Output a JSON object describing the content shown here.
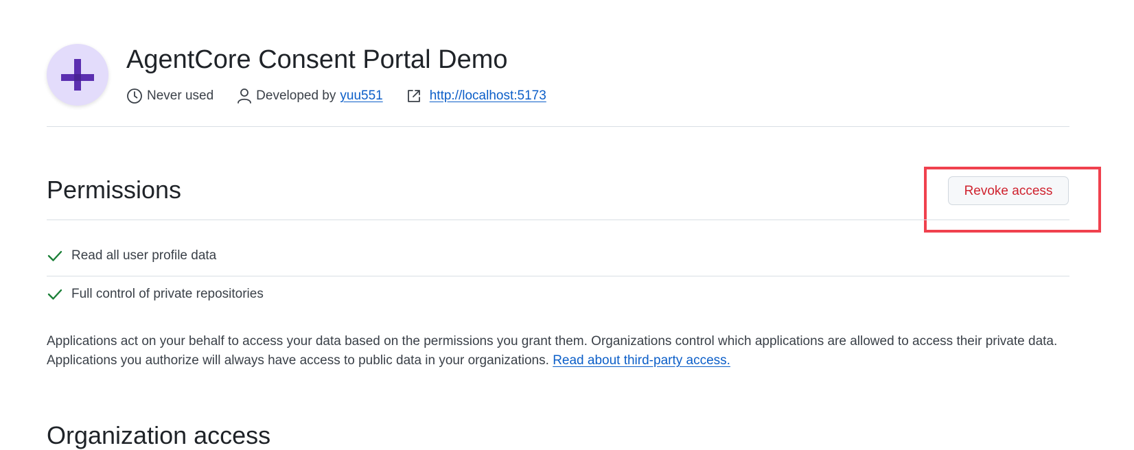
{
  "app": {
    "title": "AgentCore Consent Portal Demo",
    "last_used": "Never used",
    "developed_by_prefix": "Developed by",
    "developer": "yuu551",
    "url": "http://localhost:5173",
    "avatar_color": "#e3dcfb",
    "avatar_glyph_color": "#5b2fb0"
  },
  "permissions": {
    "title": "Permissions",
    "revoke_label": "Revoke access",
    "items": [
      {
        "label": "Read all user profile data",
        "icon": "check-icon"
      },
      {
        "label": "Full control of private repositories",
        "icon": "check-icon"
      }
    ],
    "description": "Applications act on your behalf to access your data based on the permissions you grant them. Organizations control which applications are allowed to access their private data. Applications you authorize will always have access to public data in your organizations.",
    "learn_more_link": "Read about third-party access."
  },
  "organization": {
    "title": "Organization access"
  },
  "colors": {
    "danger": "#cf222e",
    "link": "#0b5ec8",
    "success": "#1a7f37",
    "highlight": "#f0414e"
  }
}
